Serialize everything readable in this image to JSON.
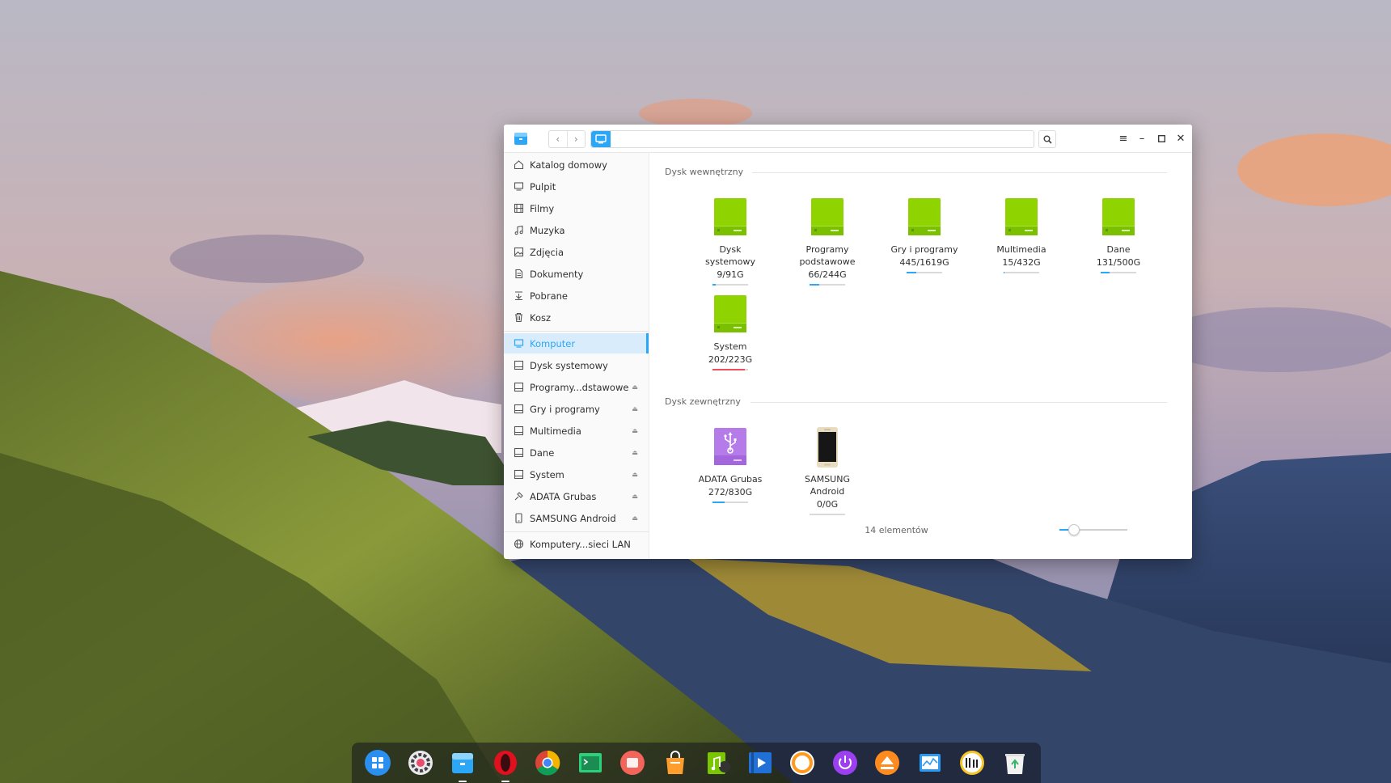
{
  "window": {
    "title_icon": "file-manager-icon",
    "address_icon": "computer-icon"
  },
  "sidebar": {
    "places": [
      {
        "label": "Katalog domowy",
        "icon": "home-icon"
      },
      {
        "label": "Pulpit",
        "icon": "desktop-icon"
      },
      {
        "label": "Filmy",
        "icon": "film-icon"
      },
      {
        "label": "Muzyka",
        "icon": "music-icon"
      },
      {
        "label": "Zdjęcia",
        "icon": "image-icon"
      },
      {
        "label": "Dokumenty",
        "icon": "document-icon"
      },
      {
        "label": "Pobrane",
        "icon": "download-icon"
      },
      {
        "label": "Kosz",
        "icon": "trash-icon"
      }
    ],
    "devices": [
      {
        "label": "Komputer",
        "icon": "computer-icon",
        "active": true
      },
      {
        "label": "Dysk systemowy",
        "icon": "drive-icon"
      },
      {
        "label": "Programy...dstawowe",
        "icon": "drive-icon",
        "eject": true
      },
      {
        "label": "Gry i programy",
        "icon": "drive-icon",
        "eject": true
      },
      {
        "label": "Multimedia",
        "icon": "drive-icon",
        "eject": true
      },
      {
        "label": "Dane",
        "icon": "drive-icon",
        "eject": true
      },
      {
        "label": "System",
        "icon": "drive-icon",
        "eject": true
      },
      {
        "label": "ADATA Grubas",
        "icon": "usb-icon",
        "eject": true
      },
      {
        "label": "SAMSUNG Android",
        "icon": "phone-icon",
        "eject": true
      }
    ],
    "network": {
      "label": "Komputery...sieci LAN",
      "icon": "network-icon"
    }
  },
  "main": {
    "internal_title": "Dysk wewnętrzny",
    "external_title": "Dysk zewnętrzny",
    "internal_disks": [
      {
        "name_line1": "Dysk",
        "name_line2": "systemowy",
        "size": "9/91G",
        "usage": 0.1
      },
      {
        "name_line1": "Programy",
        "name_line2": "podstawowe",
        "size": "66/244G",
        "usage": 0.27
      },
      {
        "name_line1": "Gry i programy",
        "name_line2": "",
        "size": "445/1619G",
        "usage": 0.27
      },
      {
        "name_line1": "Multimedia",
        "name_line2": "",
        "size": "15/432G",
        "usage": 0.03
      },
      {
        "name_line1": "Dane",
        "name_line2": "",
        "size": "131/500G",
        "usage": 0.26
      },
      {
        "name_line1": "System",
        "name_line2": "",
        "size": "202/223G",
        "usage": 0.91
      }
    ],
    "external_disks": [
      {
        "name_line1": "ADATA Grubas",
        "name_line2": "",
        "size": "272/830G",
        "usage": 0.33,
        "type": "usb"
      },
      {
        "name_line1": "SAMSUNG",
        "name_line2": "Android",
        "size": "0/0G",
        "usage": 0.0,
        "type": "phone"
      }
    ],
    "status": "14 elementów",
    "zoom_level": 0.2
  },
  "dock": {
    "items": [
      "launcher-icon",
      "settings-icon",
      "file-manager-icon",
      "opera-icon",
      "chrome-icon",
      "terminal-icon",
      "screen-recorder-icon",
      "app-store-icon",
      "music-player-icon",
      "video-player-icon",
      "browser-icon",
      "power-icon",
      "eject-icon",
      "system-monitor-icon",
      "clock-icon",
      "trash-icon"
    ]
  },
  "colors": {
    "accent": "#2ca7f8",
    "disk_green": "#8fd400",
    "usb_purple": "#b57be8",
    "usage_critical": "#f04e5e"
  }
}
